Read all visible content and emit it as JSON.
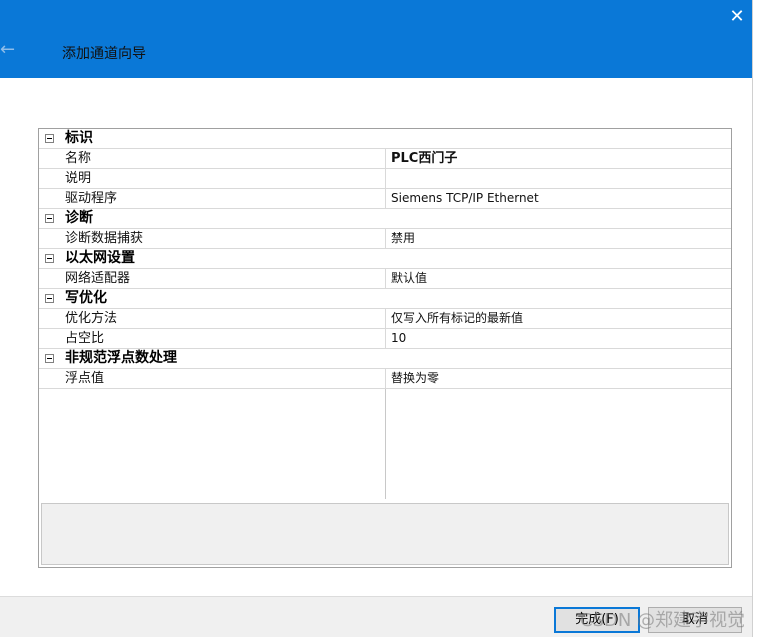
{
  "window": {
    "title": "添加通道向导",
    "back_icon": "←",
    "close_icon": "✕"
  },
  "properties": [
    {
      "type": "category",
      "label": "标识"
    },
    {
      "type": "property",
      "name": "名称",
      "value": "PLC西门子",
      "bold": true
    },
    {
      "type": "property",
      "name": "说明",
      "value": ""
    },
    {
      "type": "property",
      "name": "驱动程序",
      "value": "Siemens TCP/IP Ethernet"
    },
    {
      "type": "category",
      "label": "诊断"
    },
    {
      "type": "property",
      "name": "诊断数据捕获",
      "value": "禁用"
    },
    {
      "type": "category",
      "label": "以太网设置"
    },
    {
      "type": "property",
      "name": "网络适配器",
      "value": "默认值"
    },
    {
      "type": "category",
      "label": "写优化"
    },
    {
      "type": "property",
      "name": "优化方法",
      "value": "仅写入所有标记的最新值"
    },
    {
      "type": "property",
      "name": "占空比",
      "value": "10"
    },
    {
      "type": "category",
      "label": "非规范浮点数处理"
    },
    {
      "type": "property",
      "name": "浮点值",
      "value": "替换为零"
    }
  ],
  "footer": {
    "finish_label": "完成(F)",
    "cancel_label": "取消",
    "watermark": "CSDN @郑建宇视觉"
  },
  "colors": {
    "accent": "#0a78d7",
    "background": "#ffffff"
  }
}
